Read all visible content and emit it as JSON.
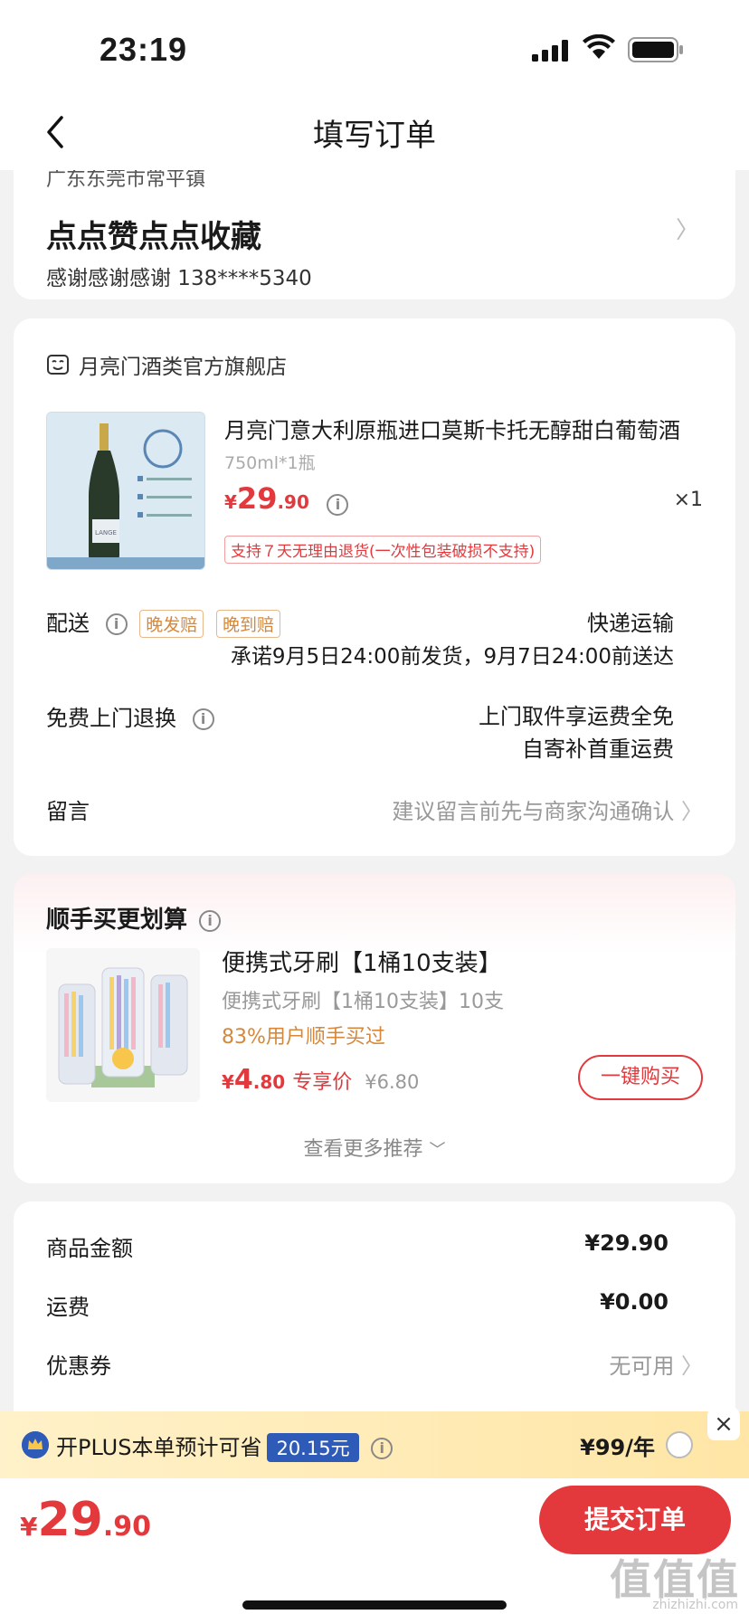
{
  "status": {
    "time": "23:19"
  },
  "nav": {
    "title": "填写订单"
  },
  "address": {
    "region_cut": "广东东莞市常平镇",
    "name": "点点赞点点收藏",
    "contact": "感谢感谢感谢  138****5340"
  },
  "shop": {
    "name": "月亮门酒类官方旗舰店",
    "product": {
      "title": "月亮门意大利原瓶进口莫斯卡托无醇甜白葡萄酒",
      "spec": "750ml*1瓶",
      "price_cur": "¥",
      "price_int": "29",
      "price_dec": ".90",
      "qty": "×1",
      "return_tag": "支持７天无理由退货(一次性包装破损不支持)"
    },
    "delivery": {
      "label": "配送",
      "badge1": "晚发赔",
      "badge2": "晚到赔",
      "method": "快递运输",
      "promise": "承诺9月5日24:00前发货，9月7日24:00前送达"
    },
    "exchange": {
      "label": "免费上门退换",
      "line1": "上门取件享运费全免",
      "line2": "自寄补首重运费"
    },
    "message": {
      "label": "留言",
      "placeholder": "建议留言前先与商家沟通确认"
    }
  },
  "recommend": {
    "title": "顺手买更划算",
    "name": "便携式牙刷【1桶10支装】",
    "sub": "便携式牙刷【1桶10支装】10支",
    "bought": "83%用户顺手买过",
    "price_cur": "¥",
    "price_int": "4",
    "price_dec": ".80",
    "tag": "专享价",
    "orig": "¥6.80",
    "buy_label": "一键购买",
    "more_label": "查看更多推荐"
  },
  "summary": {
    "goods_label": "商品金额",
    "goods_val": "¥29.90",
    "ship_label": "运费",
    "ship_val": "¥0.00",
    "coupon_label": "优惠券",
    "coupon_val": "无可用"
  },
  "plus": {
    "text": "开PLUS本单预计可省",
    "save": "20.15元",
    "price": "¥99/年"
  },
  "bottom": {
    "cur": "¥",
    "int": "29",
    "dec": ".90",
    "submit": "提交订单"
  },
  "watermark": {
    "text": "值值值",
    "site": "zhizhizhi.com"
  },
  "colors": {
    "accent": "#e4393c",
    "plus_blue": "#2e5bb8",
    "orange": "#d6883a"
  }
}
